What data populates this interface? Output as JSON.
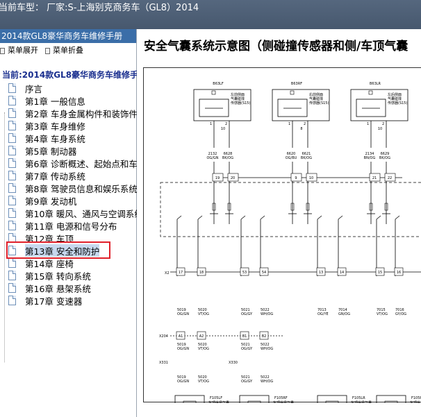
{
  "titlebar": {
    "text": "当前车型：  厂家:S-上海别克商务车（GL8）2014"
  },
  "left_panel": {
    "header": "2014款GL8豪华商务车维修手册",
    "toolbar": {
      "expand": "菜单展开",
      "collapse": "菜单折叠"
    },
    "root": "当前:2014款GL8豪华商务车维修手册",
    "items": [
      "序言",
      "第1章  一般信息",
      "第2章  车身金属构件和装饰件",
      "第3章  车身维修",
      "第4章  车身系统",
      "第5章  制动器",
      "第6章  诊断概述、起始点和车辆诊断",
      "第7章  传动系统",
      "第8章  驾驶员信息和娱乐系统",
      "第9章  发动机",
      "第10章  暖风、通风与空调系统",
      "第11章  电源和信号分布",
      "第12章  车顶",
      "第13章  安全和防护",
      "第14章  座椅",
      "第15章  转向系统",
      "第16章  悬架系统",
      "第17章  变速器"
    ],
    "selected_index": 13
  },
  "content": {
    "title": "安全气囊系统示意图（侧碰撞传感器和侧/车顶气囊",
    "diagram": {
      "sensors": [
        {
          "id": "B63LF",
          "desc": [
            "左前侧面",
            "气囊碰撞",
            "传感器(S15)"
          ]
        },
        {
          "id": "B63RF",
          "desc": [
            "右前侧面",
            "气囊碰撞",
            "传感器(S15)"
          ]
        },
        {
          "id": "B63LR",
          "desc": [
            "左后侧面",
            "气囊碰撞",
            "传感器(S15)"
          ]
        }
      ],
      "top_pins": [
        "1",
        "2",
        "1",
        "2",
        "1",
        "2"
      ],
      "top_wire_nums": [
        "10",
        "8",
        "10"
      ],
      "top_wires": [
        {
          "num": "2132",
          "color": "OG/GN"
        },
        {
          "num": "6628",
          "color": "BK/OG"
        },
        {
          "num": "6620",
          "color": "OG/BU"
        },
        {
          "num": "6621",
          "color": "BK/OG"
        },
        {
          "num": "2134",
          "color": "BN/OG"
        },
        {
          "num": "6629",
          "color": "BK/OG"
        }
      ],
      "x2_top": "X2",
      "x2_pins_top": [
        "19",
        "20",
        "9",
        "10",
        "21",
        "22"
      ],
      "x2_bottom": "X2",
      "x2_pins_bottom": [
        "17",
        "18",
        "53",
        "54",
        "13",
        "14",
        "15",
        "16"
      ],
      "mid_wires": [
        {
          "num": "5019",
          "color": "OG/GN"
        },
        {
          "num": "5020",
          "color": "VT/OG"
        },
        {
          "num": "5021",
          "color": "OG/GY"
        },
        {
          "num": "5022",
          "color": "WH/OG"
        },
        {
          "num": "7013",
          "color": "OG/YE"
        },
        {
          "num": "7014",
          "color": "GN/OG"
        },
        {
          "num": "7015",
          "color": "VT/OG"
        },
        {
          "num": "7016",
          "color": "GY/OG"
        }
      ],
      "x204": "X204",
      "x204_pins": [
        "A1",
        "A2",
        "B1",
        "B2"
      ],
      "lower_wires": [
        {
          "num": "5019",
          "color": "OG/GN"
        },
        {
          "num": "5020",
          "color": "VT/OG"
        },
        {
          "num": "5021",
          "color": "OG/GY"
        },
        {
          "num": "5022",
          "color": "WH/OG"
        }
      ],
      "x331": "X331",
      "x330": "X330",
      "bottom_wires": [
        {
          "num": "5019",
          "color": "OG/GN"
        },
        {
          "num": "5020",
          "color": "VT/OG"
        },
        {
          "num": "5021",
          "color": "OG/GY"
        },
        {
          "num": "5022",
          "color": "WH/OG"
        }
      ],
      "airbags": [
        {
          "id": "F105LF",
          "desc": [
            "车顶纵梁气囊",
            "—左前"
          ]
        },
        {
          "id": "F105RF",
          "desc": [
            "车顶纵梁气囊",
            "—右前"
          ]
        },
        {
          "id": "F105LR",
          "desc": [
            "车顶纵梁气囊",
            "—左后"
          ]
        },
        {
          "id": "F105RR",
          "desc": [
            "车顶纵",
            "梁气囊"
          ]
        }
      ]
    }
  }
}
